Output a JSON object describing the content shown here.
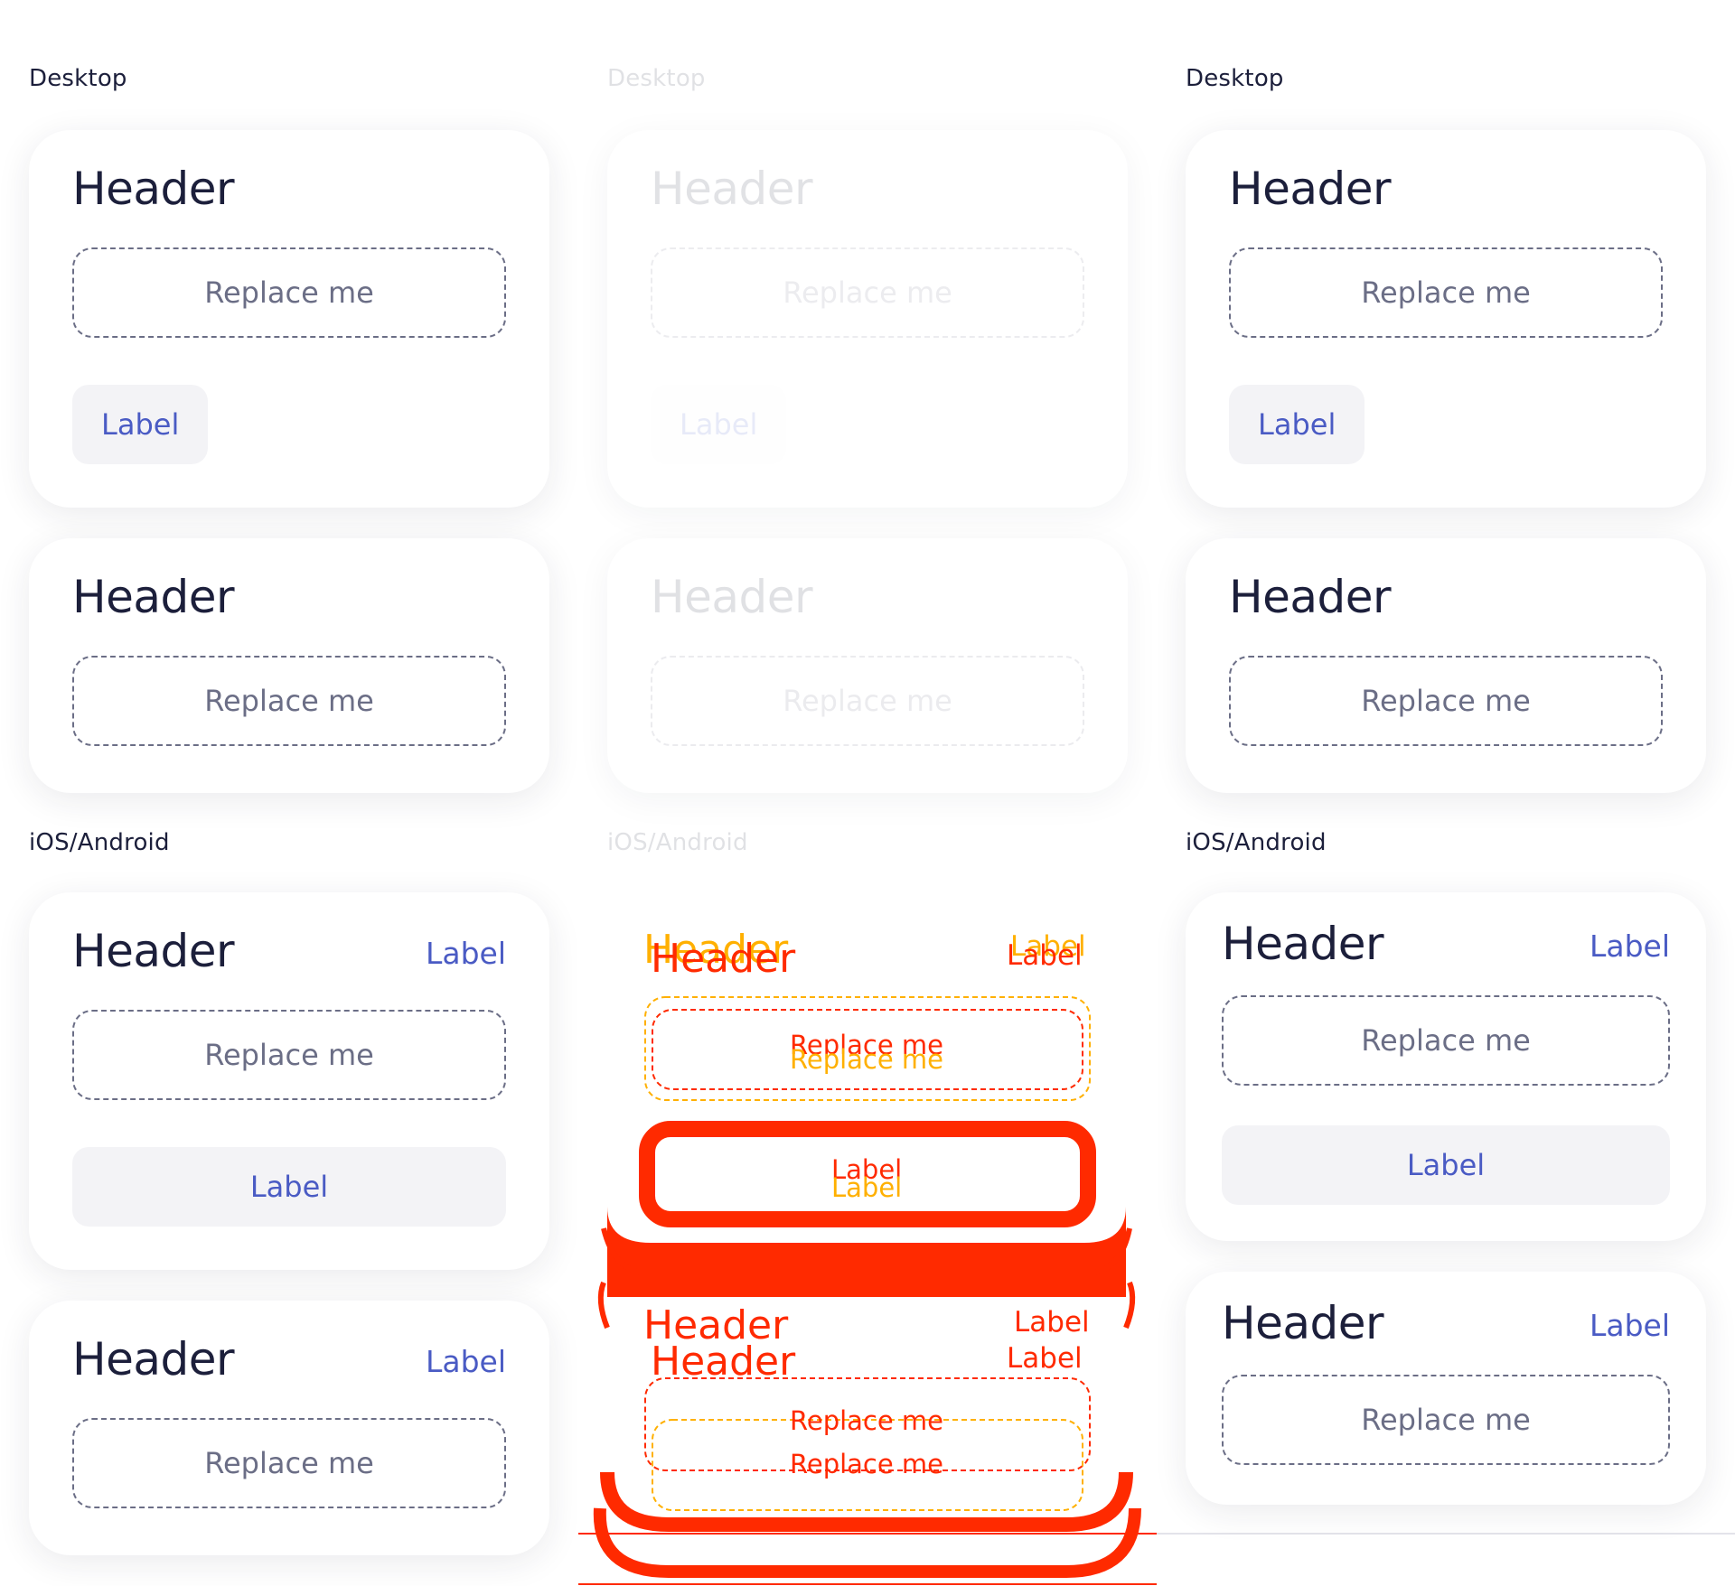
{
  "sections": {
    "desktop": "Desktop",
    "mobile": "iOS/Android"
  },
  "card": {
    "header": "Header",
    "slot": "Replace me",
    "action": "Label"
  },
  "colors": {
    "text": "#1c1f3b",
    "accent": "#4a5bc4",
    "muted": "#6b6e86",
    "chip_bg": "#f3f3f6",
    "diff_red": "#ff2a00",
    "diff_yellow": "#ffb000"
  }
}
